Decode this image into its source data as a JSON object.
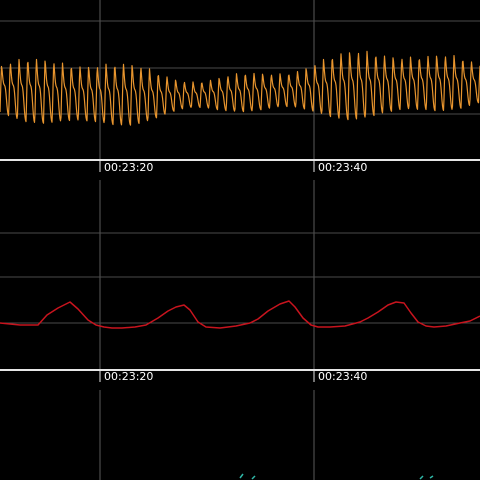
{
  "colors": {
    "background": "#000000",
    "grid": "#5a5a5a",
    "time_axis": "#e6e6e6",
    "resp_trace": "#e8952e",
    "pressure_trace": "#c8141e",
    "third_trace": "#2fb7a8"
  },
  "panels": [
    {
      "name": "respiration-panel",
      "trace": "resp",
      "time_labels": [
        "00:23:20",
        "00:23:40"
      ]
    },
    {
      "name": "pressure-panel",
      "trace": "pressure",
      "time_labels": [
        "00:23:20",
        "00:23:40"
      ]
    },
    {
      "name": "third-panel",
      "trace": "third",
      "time_labels": []
    }
  ]
}
